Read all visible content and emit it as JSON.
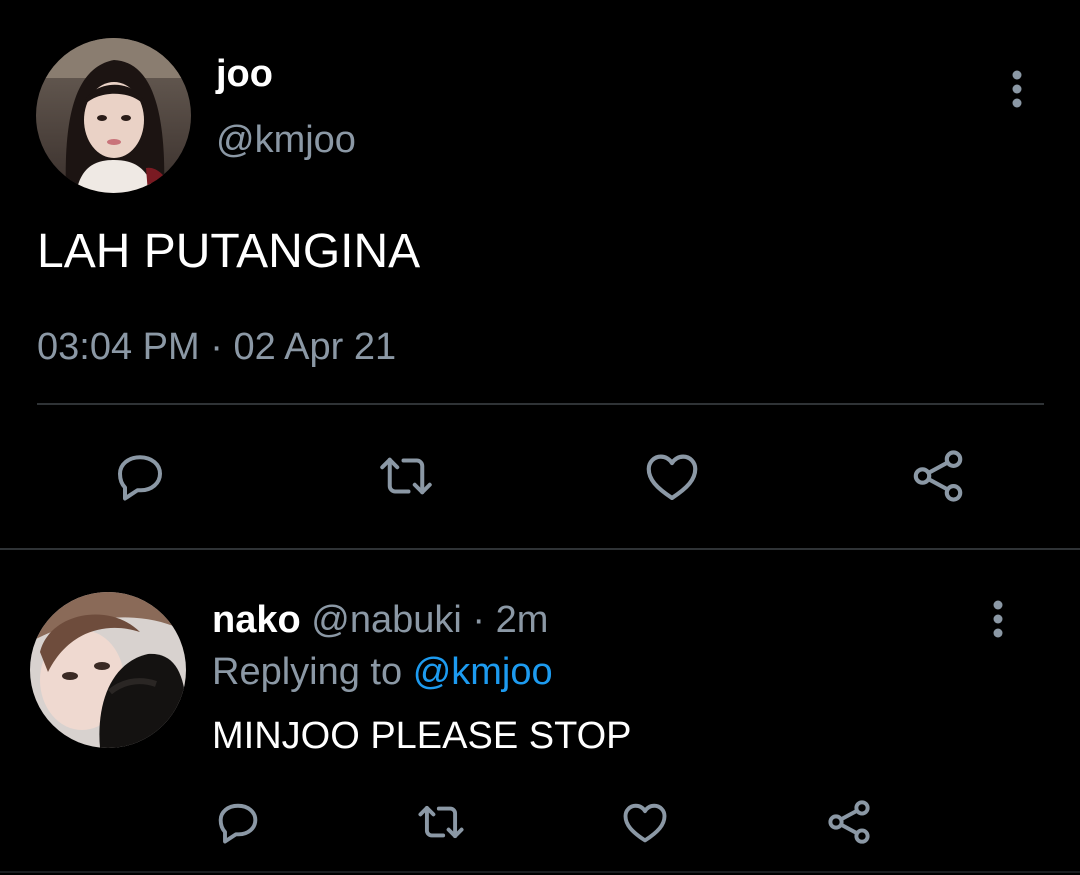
{
  "main_tweet": {
    "display_name": "joo",
    "handle": "@kmjoo",
    "text": "LAH PUTANGINA",
    "time": "03:04 PM",
    "separator": "·",
    "date": "02 Apr 21"
  },
  "actions": [
    "reply-icon",
    "retweet-icon",
    "like-icon",
    "share-icon"
  ],
  "reply_tweet": {
    "display_name": "nako",
    "handle": "@nabuki",
    "separator": "·",
    "time": "2m",
    "replying_prefix": "Replying to",
    "replying_to": "@kmjoo",
    "text": "MINJOO PLEASE STOP"
  },
  "colors": {
    "background": "#000000",
    "text_primary": "#ffffff",
    "text_secondary": "#8b98a5",
    "accent": "#1d9bf0",
    "divider": "#2f3336"
  }
}
